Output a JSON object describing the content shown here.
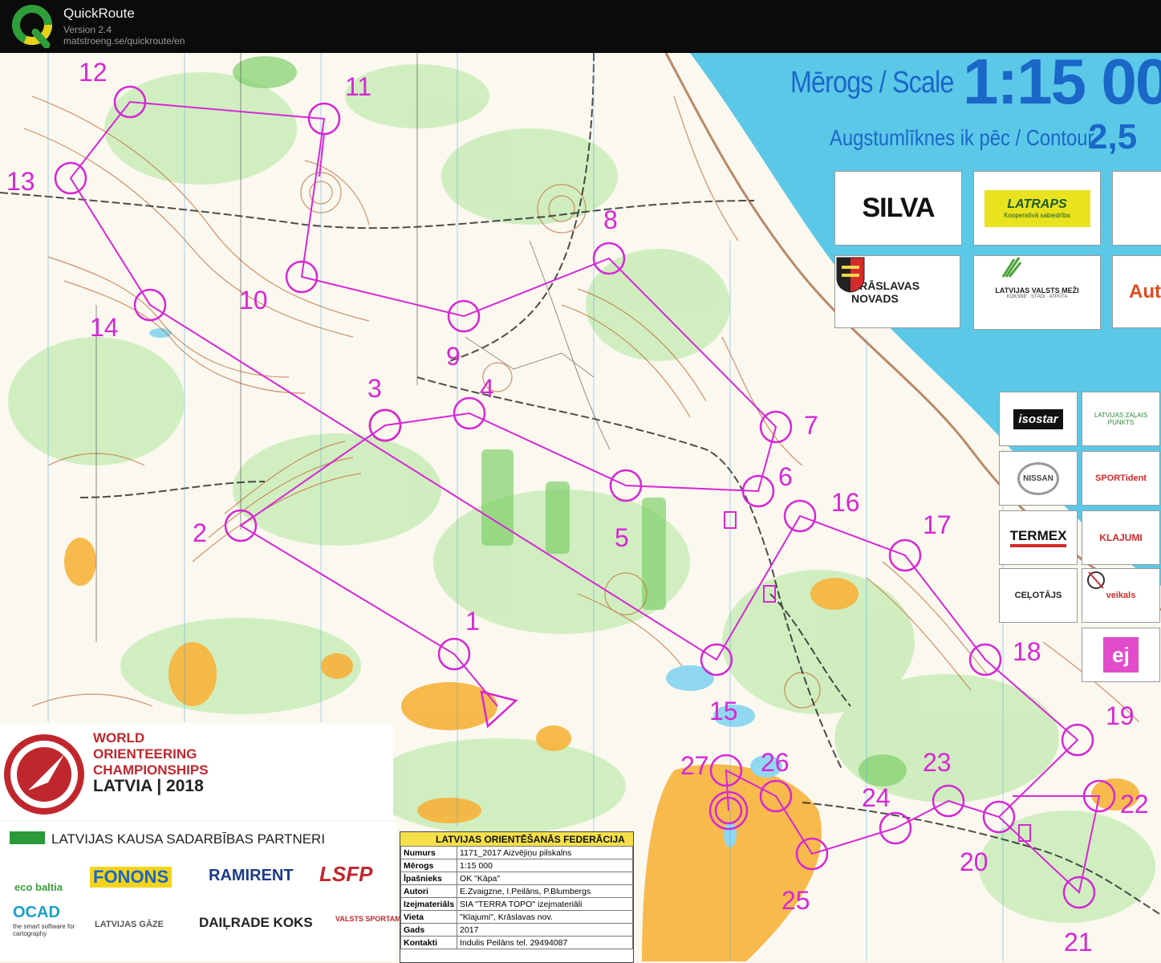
{
  "window": {
    "app_name": "QuickRoute",
    "version": "Version 2.4",
    "url": "matstroeng.se/quickroute/en"
  },
  "map": {
    "scale_label": "Mērogs / Scale",
    "scale_value": "1:15 00",
    "contour_label": "Augstumlīknes ik pēc / Contour",
    "contour_value": "2,5",
    "controls": [
      {
        "id": "1",
        "label": "1"
      },
      {
        "id": "2",
        "label": "2"
      },
      {
        "id": "3",
        "label": "3"
      },
      {
        "id": "4",
        "label": "4"
      },
      {
        "id": "5",
        "label": "5"
      },
      {
        "id": "6",
        "label": "6"
      },
      {
        "id": "7",
        "label": "7"
      },
      {
        "id": "8",
        "label": "8"
      },
      {
        "id": "9",
        "label": "9"
      },
      {
        "id": "10",
        "label": "10"
      },
      {
        "id": "11",
        "label": "11"
      },
      {
        "id": "12",
        "label": "12"
      },
      {
        "id": "13",
        "label": "13"
      },
      {
        "id": "14",
        "label": "14"
      },
      {
        "id": "15",
        "label": "15"
      },
      {
        "id": "16",
        "label": "16"
      },
      {
        "id": "17",
        "label": "17"
      },
      {
        "id": "18",
        "label": "18"
      },
      {
        "id": "19",
        "label": "19"
      },
      {
        "id": "20",
        "label": "20"
      },
      {
        "id": "21",
        "label": "21"
      },
      {
        "id": "22",
        "label": "22"
      },
      {
        "id": "23",
        "label": "23"
      },
      {
        "id": "24",
        "label": "24"
      },
      {
        "id": "25",
        "label": "25"
      },
      {
        "id": "26",
        "label": "26"
      },
      {
        "id": "27",
        "label": "27"
      }
    ],
    "course_color": "#d627d6",
    "water_color": "#5cc8e8"
  },
  "sponsors": {
    "silva": "SILVA",
    "latraps": "LATRAPS",
    "latraps_sub": "Kooperatīvā sabiedrība",
    "kraslava": "KRĀSLAVAS NOVADS",
    "lvm": "LATVIJAS VALSTS MEŽI",
    "lvm_sub": "KOKSNE · STĀDI · ATPŪTA",
    "auto": "Aut",
    "isostar": "isostar",
    "zalais": "LATVIJAS ZAĻAIS PUNKTS",
    "nissan": "NISSAN",
    "sportident": "SPORTident",
    "termex": "TERMEX",
    "klajumi": "KLAJUMI",
    "celotajs": "CEĻOTĀJS",
    "veikals": "veikals",
    "ej": "ej"
  },
  "woc": {
    "line1": "WORLD",
    "line2": "ORIENTEERING",
    "line3": "CHAMPIONSHIPS",
    "line4": "LATVIA | 2018"
  },
  "partners": {
    "title": "LATVIJAS KAUSA SADARBĪBAS PARTNERI",
    "ecobaltia": "eco baltia",
    "fonons": "FONONS",
    "ramirent": "RAMIRENT",
    "lsfp": "LSFP",
    "ocad": "OCAD",
    "ocad_sub": "the smart software for cartography",
    "gaze": "LATVIJAS GĀZE",
    "dailrade": "DAIĻRADE KOKS",
    "valsts": "VALSTS SPORTAM"
  },
  "info": {
    "header": "LATVIJAS ORIENTĒŠANĀS FEDERĀCIJA",
    "rows": [
      {
        "k": "Numurs",
        "v": "1171_2017 Aizvējiņu pilskalns"
      },
      {
        "k": "Mērogs",
        "v": "1:15 000"
      },
      {
        "k": "Īpašnieks",
        "v": "OK \"Kāpa\""
      },
      {
        "k": "Autori",
        "v": "E.Zvaigzne, I.Peilāns, P.Blumbergs"
      },
      {
        "k": "Izejmateriāls",
        "v": "SIA \"TERRA TOPO\" izejmateriāli"
      },
      {
        "k": "Vieta",
        "v": "\"Klajumi\", Krāslavas nov."
      },
      {
        "k": "Gads",
        "v": "2017"
      },
      {
        "k": "Kontakti",
        "v": "Indulis Peilāns tel. 29494087"
      }
    ]
  }
}
